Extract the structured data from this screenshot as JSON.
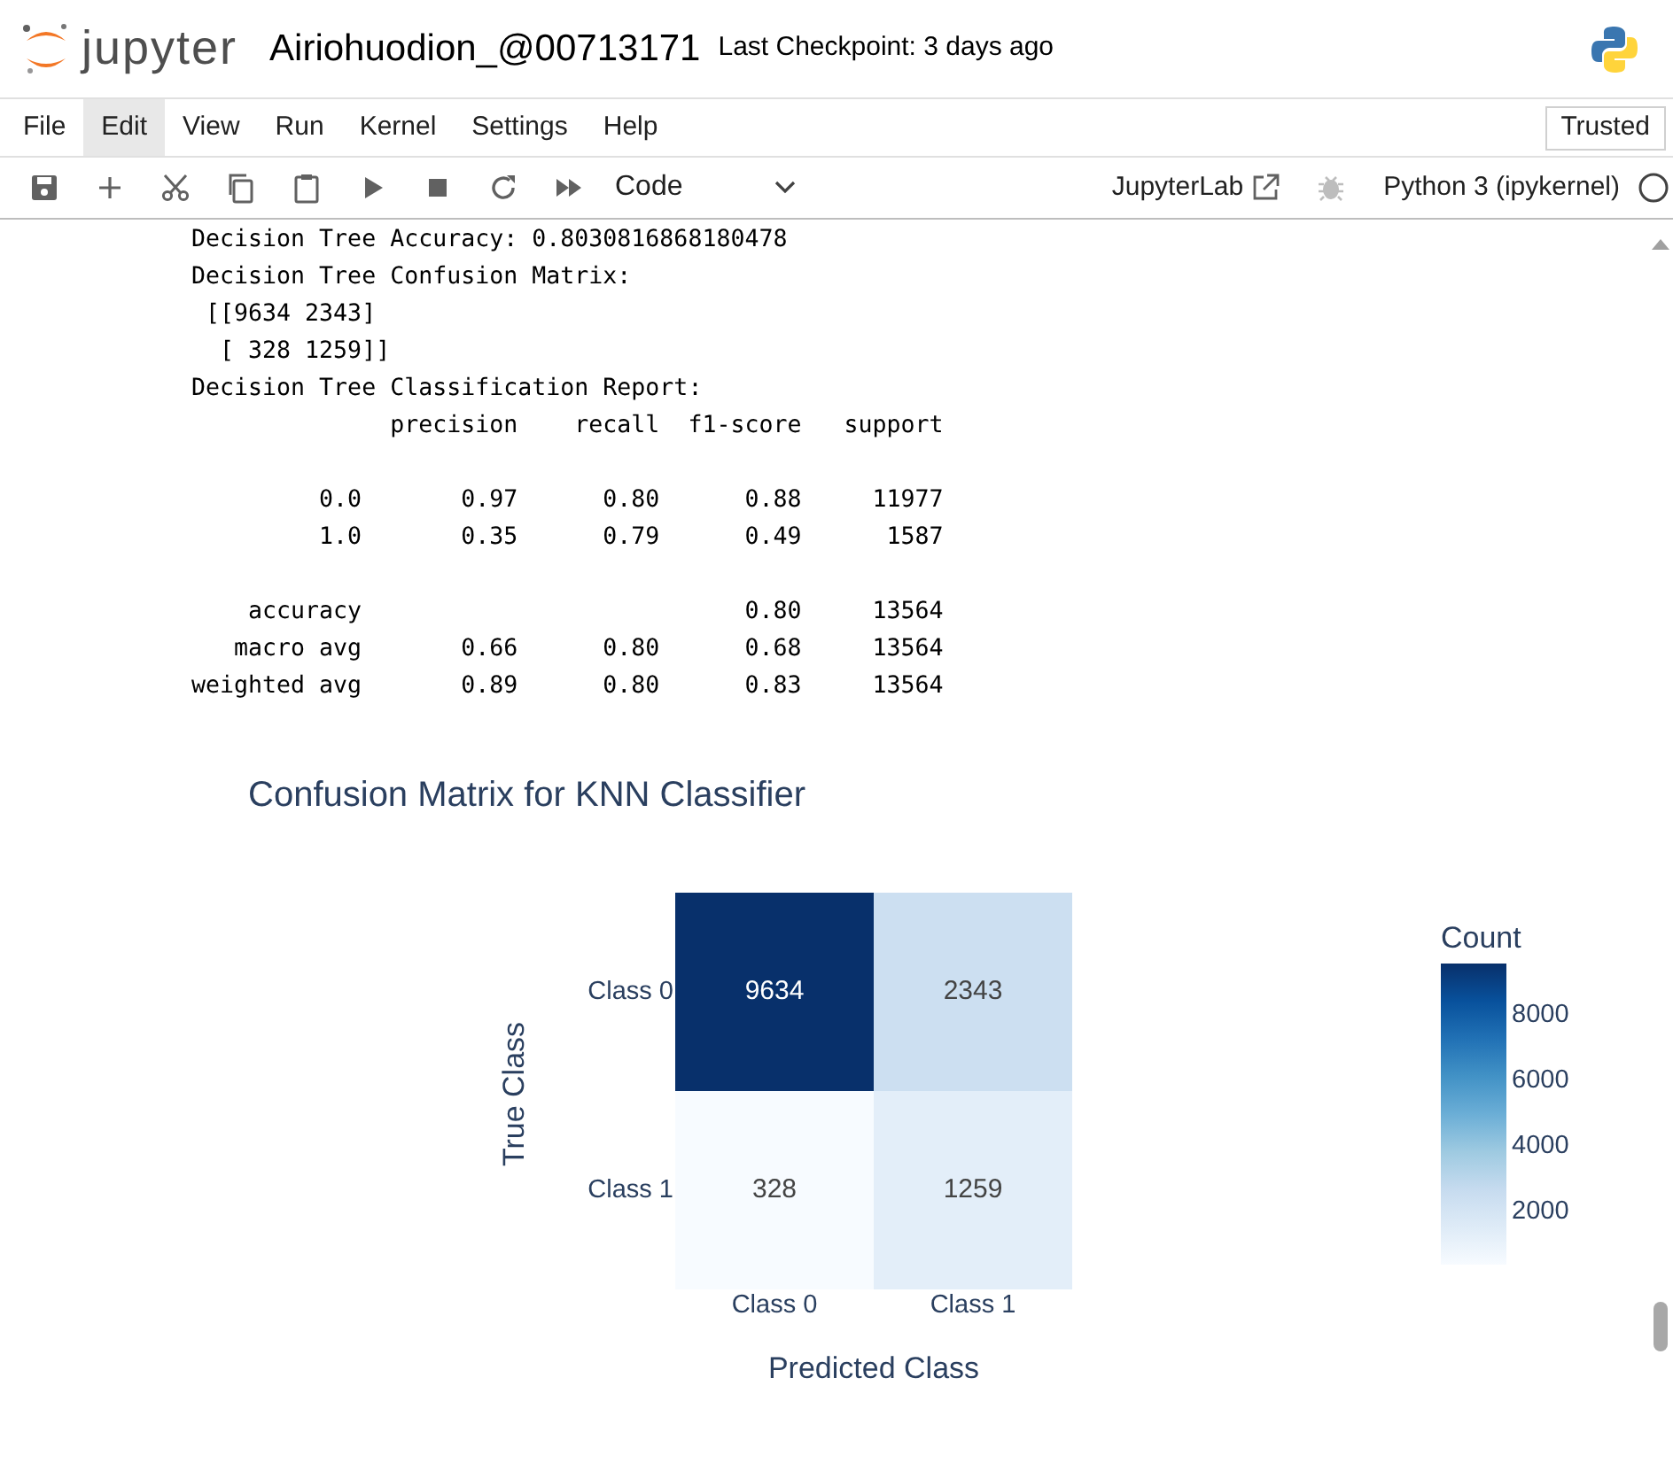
{
  "header": {
    "logo_text": "jupyter",
    "notebook_title": "Airiohuodion_@00713171",
    "checkpoint": "Last Checkpoint: 3 days ago"
  },
  "menu": [
    {
      "label": "File",
      "selected": false
    },
    {
      "label": "Edit",
      "selected": true
    },
    {
      "label": "View",
      "selected": false
    },
    {
      "label": "Run",
      "selected": false
    },
    {
      "label": "Kernel",
      "selected": false
    },
    {
      "label": "Settings",
      "selected": false
    },
    {
      "label": "Help",
      "selected": false
    }
  ],
  "trusted": "Trusted",
  "toolbar": {
    "cell_type": "Code",
    "jupyterlab_link": "JupyterLab",
    "kernel": "Python 3 (ipykernel)",
    "kernel_busy": false
  },
  "output_groups": [
    {
      "lines": [
        "Decision Tree Accuracy: 0.8030816868180478",
        "Decision Tree Confusion Matrix:",
        " [[9634 2343]",
        "  [ 328 1259]]",
        "Decision Tree Classification Report:",
        "              precision    recall  f1-score   support"
      ]
    },
    {
      "lines": [
        "         0.0       0.97      0.80      0.88     11977",
        "         1.0       0.35      0.79      0.49      1587"
      ]
    },
    {
      "lines": [
        "    accuracy                           0.80     13564",
        "   macro avg       0.66      0.80      0.68     13564",
        "weighted avg       0.89      0.80      0.83     13564"
      ]
    }
  ],
  "heatmap": {
    "title": "Confusion Matrix for KNN Classifier",
    "xlabel": "Predicted Class",
    "ylabel": "True Class",
    "x_categories": [
      "Class 0",
      "Class 1"
    ],
    "y_categories": [
      "Class 0",
      "Class 1"
    ],
    "cells": [
      [
        "9634",
        "2343"
      ],
      [
        "328",
        "1259"
      ]
    ],
    "colorbar": {
      "title": "Count",
      "ticks": [
        "8000",
        "6000",
        "4000",
        "2000"
      ]
    }
  }
}
